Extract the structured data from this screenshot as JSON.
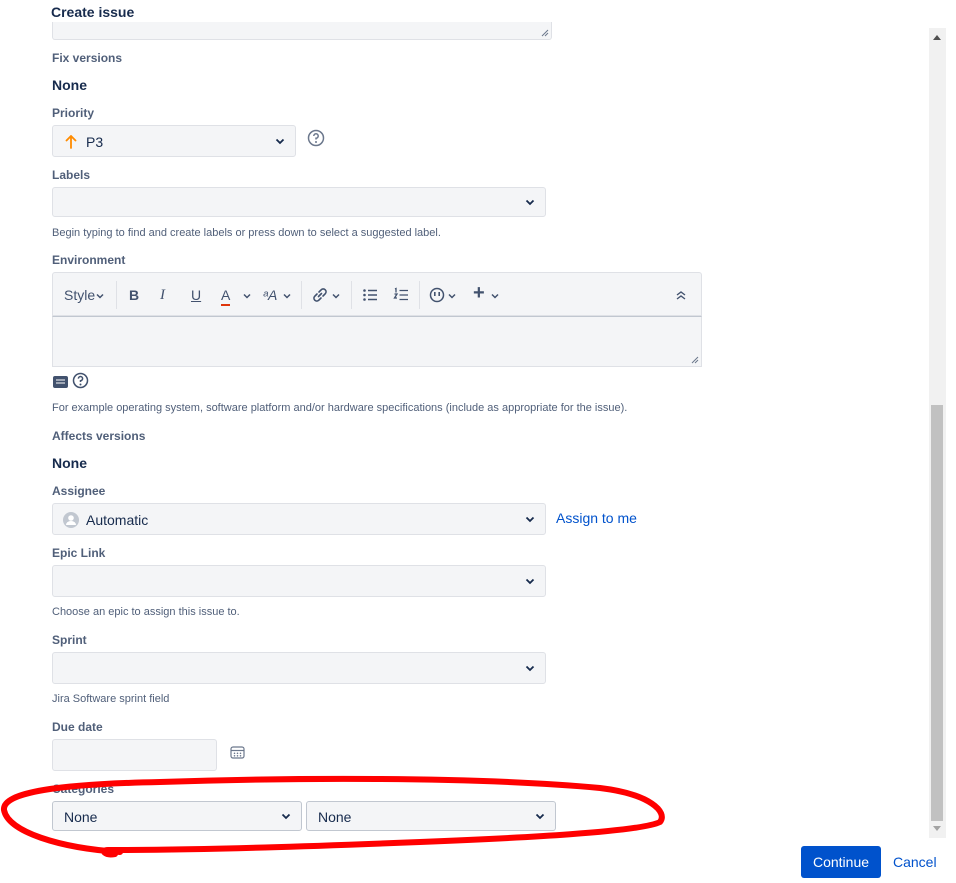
{
  "dialog": {
    "title": "Create issue"
  },
  "fields": {
    "fix_versions": {
      "label": "Fix versions",
      "value": "None"
    },
    "priority": {
      "label": "Priority",
      "value": "P3",
      "icon": "arrow-up-icon",
      "icon_color": "#ff8b00"
    },
    "labels": {
      "label": "Labels",
      "value": "",
      "help": "Begin typing to find and create labels or press down to select a suggested label."
    },
    "environment": {
      "label": "Environment",
      "toolbar": {
        "style_label": "Style",
        "bold": "B",
        "italic": "I",
        "underline": "U",
        "text_color": "A",
        "more_format": "ᵃA",
        "plus": "+"
      },
      "help": "For example operating system, software platform and/or hardware specifications (include as appropriate for the issue)."
    },
    "affects_versions": {
      "label": "Affects versions",
      "value": "None"
    },
    "assignee": {
      "label": "Assignee",
      "value": "Automatic",
      "assign_to_me": "Assign to me"
    },
    "epic_link": {
      "label": "Epic Link",
      "value": "",
      "help": "Choose an epic to assign this issue to."
    },
    "sprint": {
      "label": "Sprint",
      "value": "",
      "help": "Jira Software sprint field"
    },
    "due_date": {
      "label": "Due date",
      "value": ""
    },
    "categories": {
      "label": "Categories",
      "first_value": "None",
      "second_value": "None"
    }
  },
  "footer": {
    "continue_label": "Continue",
    "cancel_label": "Cancel"
  },
  "colors": {
    "primary": "#0052cc",
    "annotation": "#ff0000",
    "field_bg": "#f4f5f7"
  }
}
